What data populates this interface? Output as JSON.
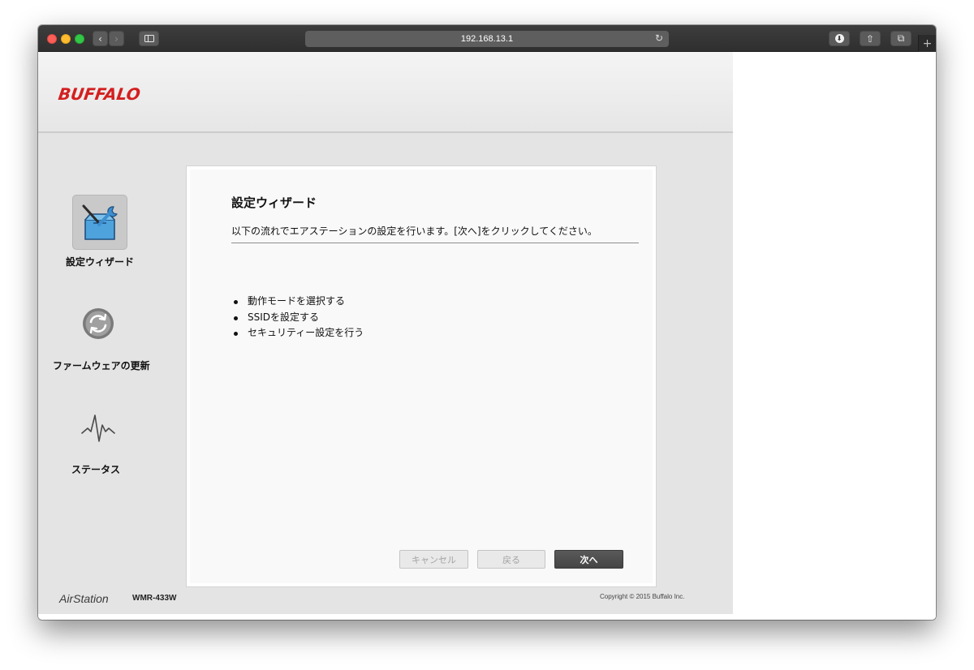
{
  "browser": {
    "url": "192.168.13.1",
    "reload_glyph": "↻",
    "back_glyph": "‹",
    "forward_glyph": "›",
    "new_tab_glyph": "+",
    "download_glyph": "⬇",
    "share_glyph": "⇧",
    "tabs_glyph": "⧉"
  },
  "header": {
    "logo": "BUFFALO"
  },
  "sidebar": {
    "items": [
      {
        "label": "設定ウィザード",
        "icon": "toolbox-wrench-icon",
        "active": true
      },
      {
        "label": "ファームウェアの更新",
        "icon": "refresh-icon",
        "active": false
      },
      {
        "label": "ステータス",
        "icon": "pulse-icon",
        "active": false
      }
    ]
  },
  "wizard": {
    "title": "設定ウィザード",
    "description": "以下の流れでエアステーションの設定を行います。[次へ]をクリックしてください。",
    "steps": [
      "動作モードを選択する",
      "SSIDを設定する",
      "セキュリティー設定を行う"
    ],
    "buttons": {
      "cancel": "キャンセル",
      "back": "戻る",
      "next": "次へ"
    }
  },
  "footer": {
    "brand": "AirStation",
    "model": "WMR-433W",
    "copyright": "Copyright © 2015 Buffalo Inc."
  },
  "colors": {
    "brand": "#d41f1f",
    "accent": "#4a90c8",
    "primary_button": "#4f4f4f"
  }
}
